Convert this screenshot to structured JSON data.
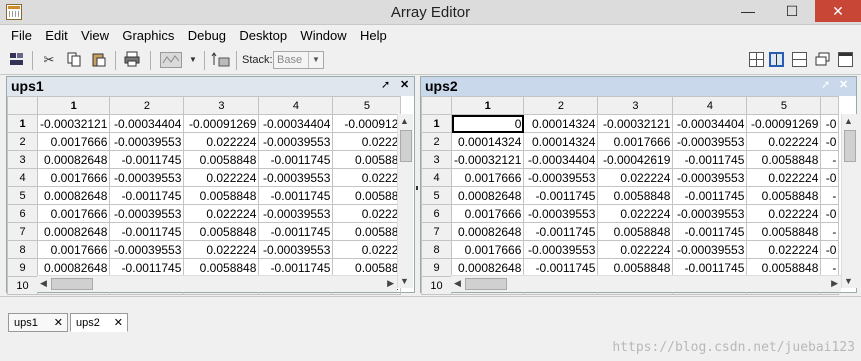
{
  "window": {
    "title": "Array Editor",
    "controls": {
      "minimize": "—",
      "maximize": "☐",
      "close": "✕"
    }
  },
  "menu": [
    "File",
    "Edit",
    "View",
    "Graphics",
    "Debug",
    "Desktop",
    "Window",
    "Help"
  ],
  "toolbar": {
    "icons": [
      "dock-icon",
      "cut-icon",
      "copy-icon",
      "paste-icon",
      "print-icon",
      "plot-icon",
      "plot-dropdown-icon",
      "transpose-icon"
    ],
    "stack_label": "Stack:",
    "stack_value": "Base"
  },
  "panels": [
    {
      "name": "ups1",
      "columns": [
        "1",
        "2",
        "3",
        "4",
        "5"
      ],
      "rows": [
        "1",
        "2",
        "3",
        "4",
        "5",
        "6",
        "7",
        "8",
        "9",
        "10"
      ],
      "cells": [
        [
          "-0.00032121",
          "-0.00034404",
          "-0.00091269",
          "-0.00034404",
          "-0.000912"
        ],
        [
          "0.0017666",
          "-0.00039553",
          "0.022224",
          "-0.00039553",
          "0.0222"
        ],
        [
          "0.00082648",
          "-0.0011745",
          "0.0058848",
          "-0.0011745",
          "0.00588"
        ],
        [
          "0.0017666",
          "-0.00039553",
          "0.022224",
          "-0.00039553",
          "0.0222"
        ],
        [
          "0.00082648",
          "-0.0011745",
          "0.0058848",
          "-0.0011745",
          "0.00588"
        ],
        [
          "0.0017666",
          "-0.00039553",
          "0.022224",
          "-0.00039553",
          "0.0222"
        ],
        [
          "0.00082648",
          "-0.0011745",
          "0.0058848",
          "-0.0011745",
          "0.00588"
        ],
        [
          "0.0017666",
          "-0.00039553",
          "0.022224",
          "-0.00039553",
          "0.0222"
        ],
        [
          "0.00082648",
          "-0.0011745",
          "0.0058848",
          "-0.0011745",
          "0.00588"
        ],
        [
          "0.0017666",
          "-0.00039553",
          "0.022224",
          "-0.00039553",
          "0.0222"
        ]
      ]
    },
    {
      "name": "ups2",
      "columns": [
        "1",
        "2",
        "3",
        "4",
        "5",
        ""
      ],
      "rows": [
        "1",
        "2",
        "3",
        "4",
        "5",
        "6",
        "7",
        "8",
        "9",
        "10"
      ],
      "cells": [
        [
          "0",
          "0.00014324",
          "-0.00032121",
          "-0.00034404",
          "-0.00091269",
          "-0"
        ],
        [
          "0.00014324",
          "0.00014324",
          "0.0017666",
          "-0.00039553",
          "0.022224",
          "-0"
        ],
        [
          "-0.00032121",
          "-0.00034404",
          "-0.00042619",
          "-0.0011745",
          "0.0058848",
          "-"
        ],
        [
          "0.0017666",
          "-0.00039553",
          "0.022224",
          "-0.00039553",
          "0.022224",
          "-0"
        ],
        [
          "0.00082648",
          "-0.0011745",
          "0.0058848",
          "-0.0011745",
          "0.0058848",
          "-"
        ],
        [
          "0.0017666",
          "-0.00039553",
          "0.022224",
          "-0.00039553",
          "0.022224",
          "-0"
        ],
        [
          "0.00082648",
          "-0.0011745",
          "0.0058848",
          "-0.0011745",
          "0.0058848",
          "-"
        ],
        [
          "0.0017666",
          "-0.00039553",
          "0.022224",
          "-0.00039553",
          "0.022224",
          "-0"
        ],
        [
          "0.00082648",
          "-0.0011745",
          "0.0058848",
          "-0.0011745",
          "0.0058848",
          "-"
        ],
        [
          "0.0017666",
          "-0.00039553",
          "0.022224",
          "-0.00039553",
          "0.022224",
          "-0"
        ]
      ]
    }
  ],
  "tabs": [
    {
      "label": "ups1",
      "close": "✕"
    },
    {
      "label": "ups2",
      "close": "✕"
    }
  ],
  "watermark": "https://blog.csdn.net/juebai123",
  "colors": {
    "panel_header_active": "#c9d8ea",
    "panel_header_inactive": "#dfe6ee",
    "close_button": "#c74635"
  }
}
